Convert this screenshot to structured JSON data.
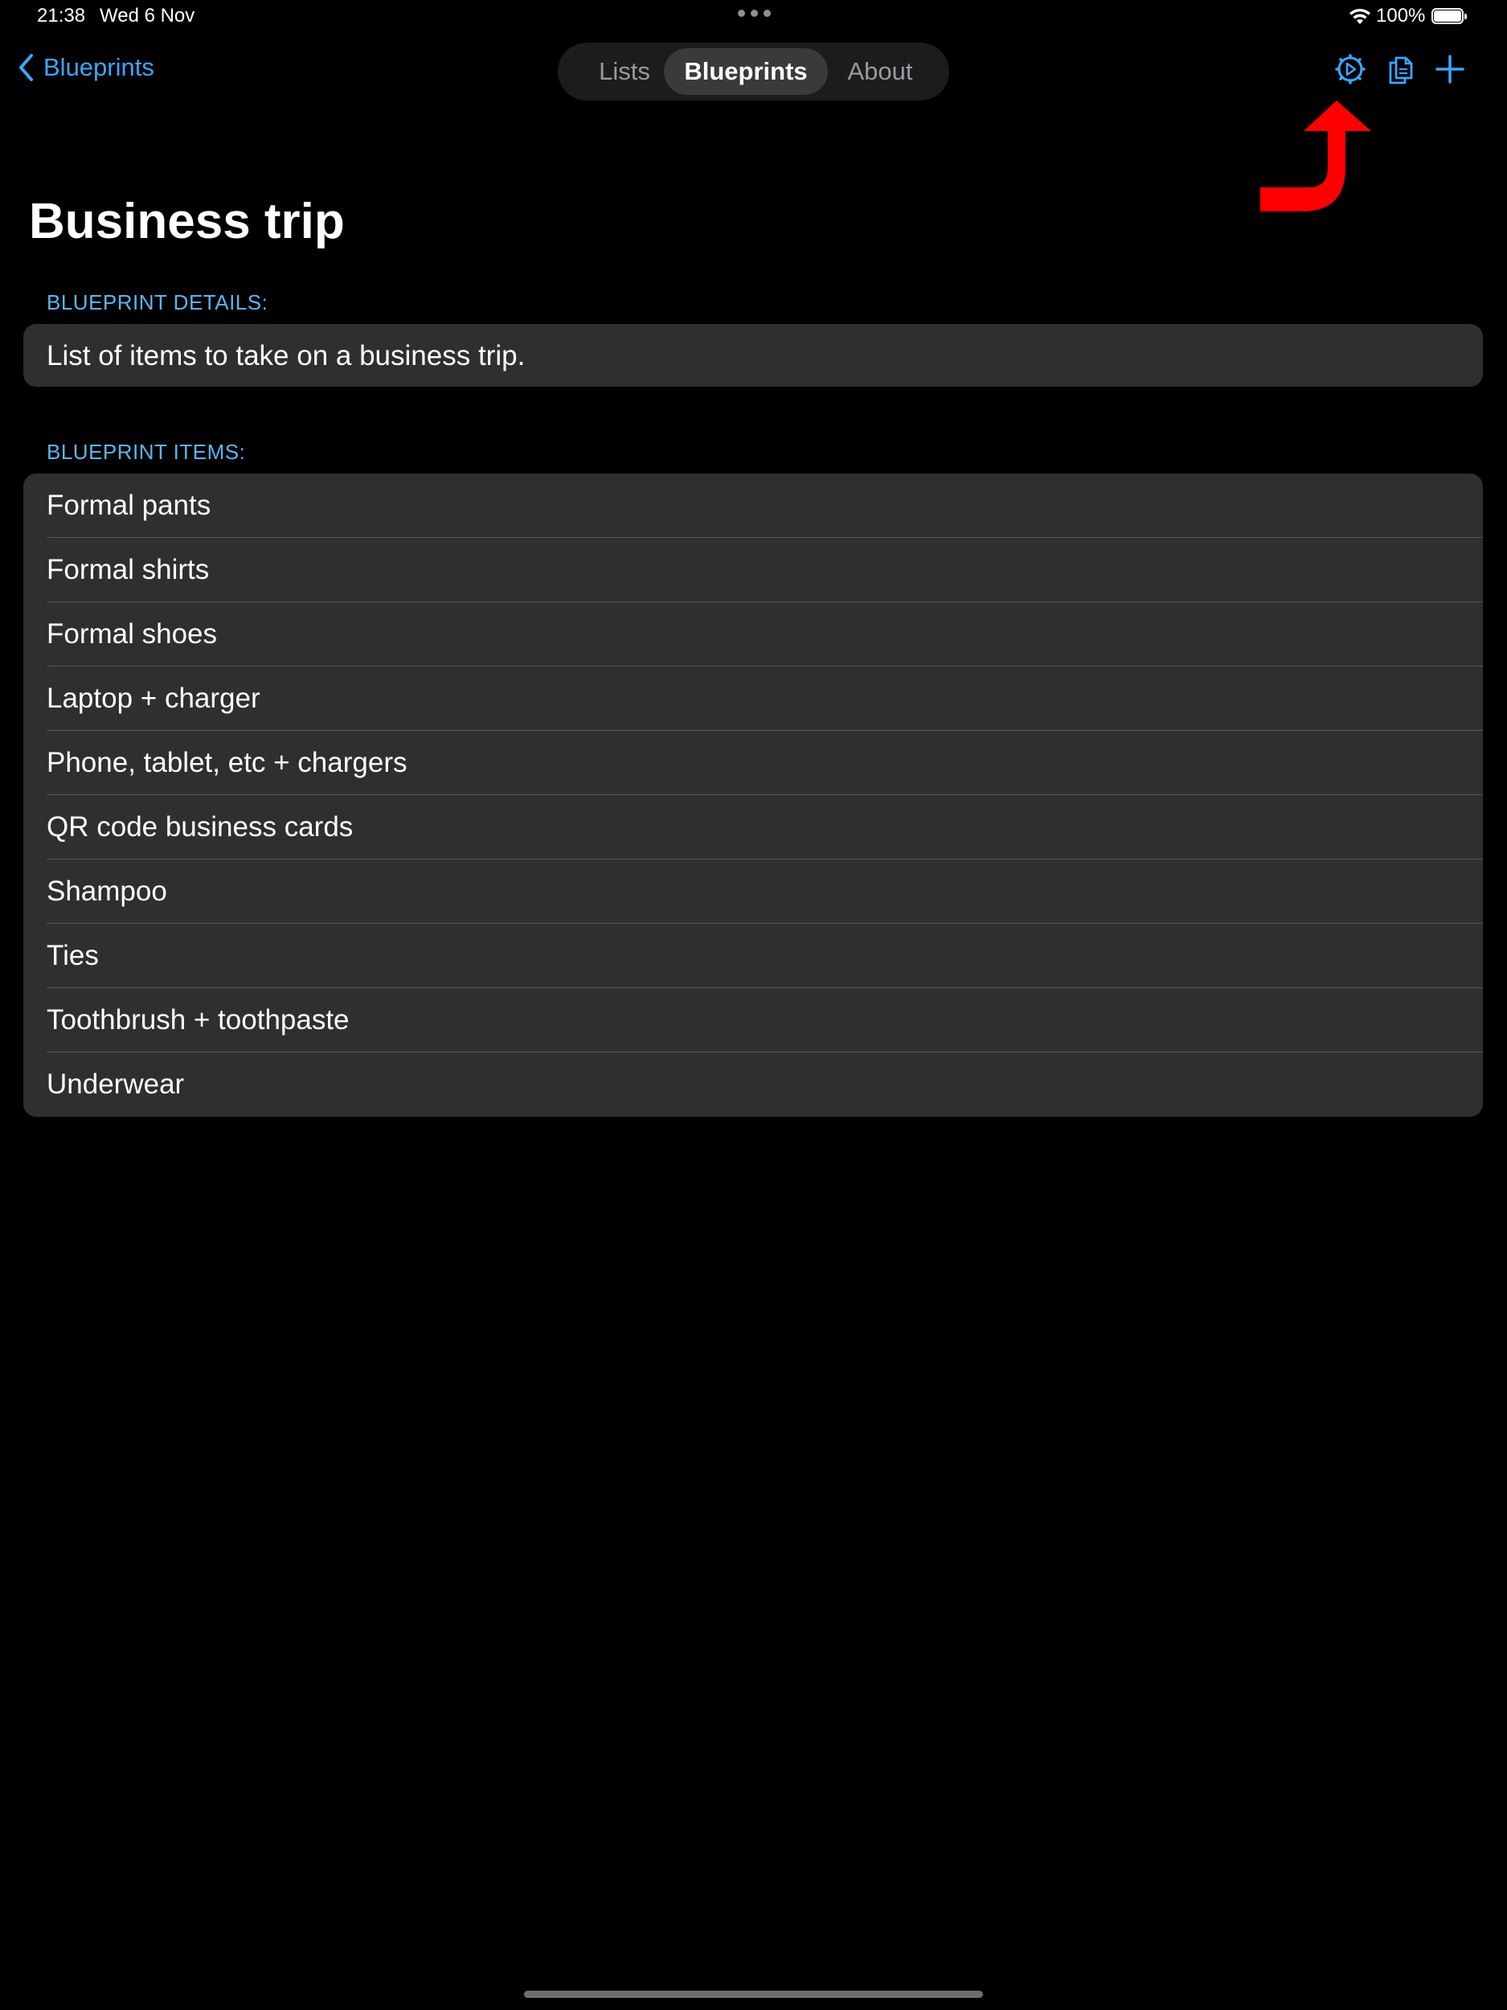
{
  "status_bar": {
    "time": "21:38",
    "date": "Wed 6 Nov",
    "battery": "100%"
  },
  "nav": {
    "back_label": "Blueprints",
    "segments": [
      "Lists",
      "Blueprints",
      "About"
    ],
    "selected_segment": "Blueprints"
  },
  "toolbar": {
    "icons": [
      "settings-icon",
      "copy-icon",
      "plus-icon"
    ]
  },
  "colors": {
    "accent": "#3aa7ff",
    "section_header": "#5ab6f2",
    "card_background": "#2f2f2f",
    "annotation": "#ff0000"
  },
  "page": {
    "title": "Business trip",
    "details_header": "BLUEPRINT DETAILS:",
    "details_text": "List of items to take on a business trip.",
    "items_header": "BLUEPRINT ITEMS:",
    "items": [
      "Formal pants",
      "Formal shirts",
      "Formal shoes",
      "Laptop + charger",
      "Phone, tablet, etc + chargers",
      "QR code business cards",
      "Shampoo",
      "Ties",
      "Toothbrush + toothpaste",
      "Underwear"
    ]
  }
}
